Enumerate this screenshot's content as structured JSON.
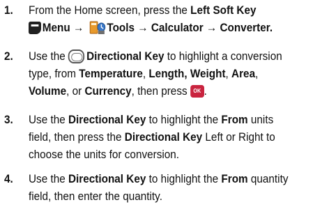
{
  "steps": [
    {
      "number": "1.",
      "lines": [
        {
          "a": "From the Home screen, press the ",
          "b": "Left Soft Key"
        },
        {
          "softkey_icon": "left-soft-key-icon",
          "a": "Menu → ",
          "tools_icon": "tools-icon",
          "b": "Tools → Calculator → Converter",
          "c": "."
        }
      ]
    },
    {
      "number": "2.",
      "lines": [
        {
          "a": "Use the ",
          "dirkey_icon": "directional-key-icon",
          "b": "Directional Key",
          "c": " to highlight a conversion"
        },
        {
          "a": "type, from ",
          "b": "Temperature",
          "c": ", ",
          "d": "Length, Weight",
          "e": ", ",
          "f": "Area",
          "g": ","
        },
        {
          "a": "Volume",
          "b": ", or ",
          "c": "Currency",
          "d": ", then press ",
          "ok_icon": "ok-key-icon",
          "ok_label": "OK",
          "e": "."
        }
      ]
    },
    {
      "number": "3.",
      "lines": [
        {
          "a": "Use the ",
          "b": "Directional Key",
          "c": " to highlight the ",
          "d": "From",
          "e": " units"
        },
        {
          "a": "field, then press the ",
          "b": "Directional Key",
          "c": " Left or Right to"
        },
        {
          "a": "choose the units for conversion."
        }
      ]
    },
    {
      "number": "4.",
      "lines": [
        {
          "a": "Use the ",
          "b": "Directional Key",
          "c": " to highlight the ",
          "d": "From",
          "e": " quantity"
        },
        {
          "a": "field, then enter the quantity."
        }
      ]
    }
  ]
}
